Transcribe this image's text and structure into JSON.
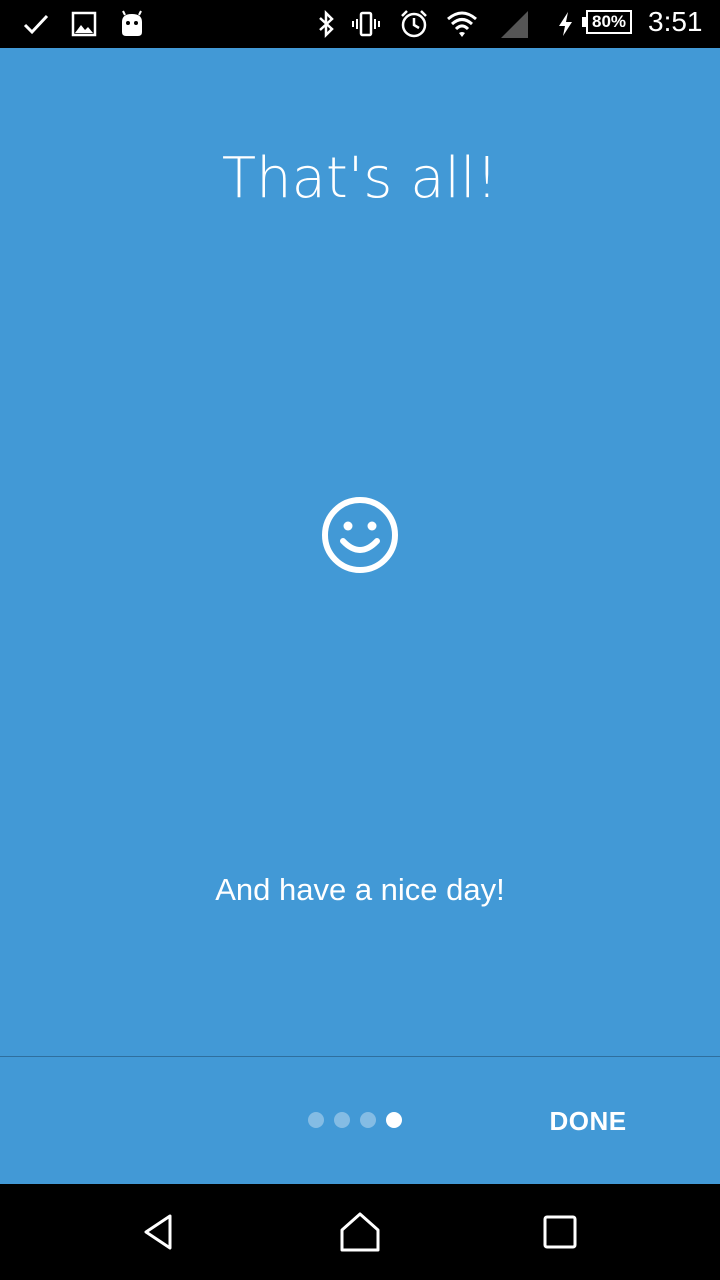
{
  "status_bar": {
    "icons_left": [
      "check-icon",
      "image-icon",
      "android-icon"
    ],
    "icons_right": [
      "bluetooth-icon",
      "vibrate-icon",
      "alarm-icon",
      "wifi-icon",
      "signal-icon",
      "charging-icon"
    ],
    "battery_level": "80%",
    "time": "3:51"
  },
  "intro": {
    "title": "That's all!",
    "icon": "smiley-icon",
    "subtitle": "And have a nice day!"
  },
  "pager": {
    "page_count": 4,
    "current_page": 4,
    "done_label": "DONE"
  },
  "nav_bar": {
    "buttons": [
      "back-icon",
      "home-icon",
      "recents-icon"
    ]
  },
  "colors": {
    "background": "#4299d6",
    "divider": "#2f6f9e",
    "text": "#ffffff",
    "system_bars": "#000000"
  }
}
